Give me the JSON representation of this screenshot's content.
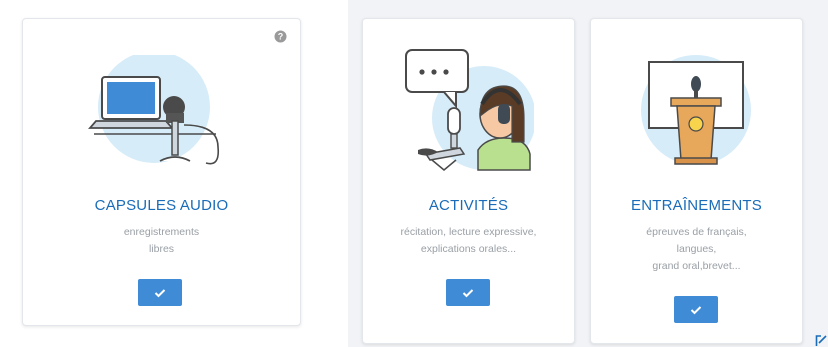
{
  "cards": [
    {
      "title": "CAPSULES AUDIO",
      "desc": [
        "enregistrements",
        "libres"
      ],
      "illustration": "laptop-microphone-illustration",
      "button_icon": "check-icon"
    },
    {
      "title": "ACTIVITÉS",
      "desc": [
        "récitation, lecture expressive,",
        "explications orales..."
      ],
      "illustration": "person-headset-speech-illustration",
      "button_icon": "check-icon"
    },
    {
      "title": "ENTRAÎNEMENTS",
      "desc": [
        "épreuves de français,",
        "langues,",
        "grand oral,brevet..."
      ],
      "illustration": "lectern-microphone-illustration",
      "button_icon": "check-icon"
    }
  ],
  "icons": {
    "help": "help-icon",
    "corner": "edit-icon"
  },
  "colors": {
    "accent": "#1a6cb8",
    "button": "#3f8bd6",
    "illustration_bg": "#d6ecf8",
    "text_muted": "#9aa0a6",
    "panel_bg": "#f1f3f6"
  }
}
